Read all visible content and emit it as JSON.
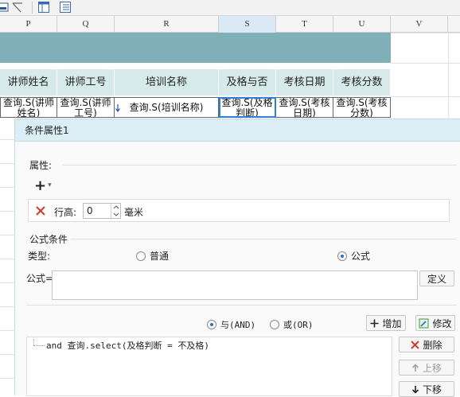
{
  "toolbar": {
    "icons": [
      "image-icon",
      "cursor-icon",
      "layout-icon",
      "list-view-icon"
    ]
  },
  "columns": [
    {
      "id": "P"
    },
    {
      "id": "Q"
    },
    {
      "id": "R"
    },
    {
      "id": "S",
      "selected": true
    },
    {
      "id": "T"
    },
    {
      "id": "U"
    },
    {
      "id": "V"
    }
  ],
  "grid": {
    "band_color": "#7fb0b8",
    "header_color": "#d7eaea",
    "headers": [
      "讲师姓名",
      "讲师工号",
      "培训名称",
      "及格与否",
      "考核日期",
      "考核分数"
    ],
    "cells": [
      "查询.S(讲师姓名)",
      "查询.S(讲师工号)",
      "查询.S(培训名称)",
      "查询.S(及格判断)",
      "查询.S(考核日期)",
      "查询.S(考核分数)"
    ]
  },
  "dialog": {
    "title": "条件属性1",
    "property_section": "属性:",
    "add_glyph": "+",
    "dropdown_glyph": "▾",
    "row_height_label": "行高:",
    "row_height_value": "0",
    "row_height_unit": "毫米",
    "formula_section": "公式条件",
    "type_label": "类型:",
    "type_options": [
      {
        "label": "普通",
        "selected": false
      },
      {
        "label": "公式",
        "selected": true
      }
    ],
    "formula_label": "公式=",
    "formula_value": "",
    "define_button": "定义",
    "logic_options": [
      {
        "label": "与(AND)",
        "selected": true
      },
      {
        "label": "或(OR)",
        "selected": false
      }
    ],
    "add_button": "增加",
    "modify_button": "修改",
    "condition_text": "and 查询.select(及格判断 = 不及格)",
    "delete_button": "删除",
    "move_up_button": "上移",
    "move_down_button": "下移",
    "accent_color": "#2f6fc0",
    "delete_color": "#d23a2a"
  }
}
